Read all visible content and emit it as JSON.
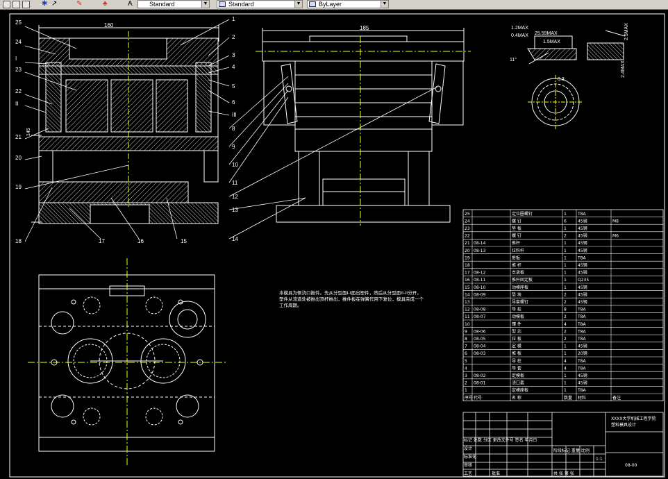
{
  "toolbar": {
    "style_combo_1": "Standard",
    "style_combo_2": "Standard",
    "style_combo_3": "ByLayer",
    "icons": [
      "new-icon",
      "open-icon",
      "save-icon",
      "pan-icon",
      "zoom-icon",
      "paint-icon",
      "text-style-icon",
      "dim-style-icon",
      "layer-icon"
    ]
  },
  "drawing": {
    "colors": {
      "line": "#ffffff",
      "hatch": "#ffffff",
      "background": "#000000",
      "yellow": "#ffff00"
    },
    "dims": {
      "width_160": "160",
      "width_185": "185",
      "height_145": "145"
    },
    "callouts_left": [
      "25",
      "24",
      "I",
      "23",
      "22",
      "II",
      "21",
      "20",
      "19",
      "18"
    ],
    "callouts_bottom": [
      "17",
      "16",
      "15"
    ],
    "callouts_right": [
      "1",
      "2",
      "3",
      "4",
      "5",
      "6",
      "7",
      "III",
      "8",
      "9",
      "10",
      "11",
      "12",
      "13",
      "14"
    ],
    "detail_labels": [
      "1.2MAX",
      "0.4MAX",
      "25.59MAX",
      "1.5MAX",
      "11°",
      "0.3",
      "2.4MAX",
      "2.5MAX"
    ],
    "notes": "本模具为侧浇口推件。先从分型面I-I面出塑件，然后从分型面II-II分开，塑件从流道处被推出顶杆推出，推件板在弹簧作用下复位，模具完成一个工作周期。"
  },
  "bom": {
    "rows": [
      {
        "no": "25",
        "code": "",
        "name": "定位圈螺钉",
        "qty": "1",
        "mat": "T8A",
        "note": ""
      },
      {
        "no": "24",
        "code": "",
        "name": "螺 钉",
        "qty": "6",
        "mat": "45钢",
        "note": "M8"
      },
      {
        "no": "23",
        "code": "",
        "name": "垫 板",
        "qty": "1",
        "mat": "45钢",
        "note": ""
      },
      {
        "no": "22",
        "code": "",
        "name": "螺 钉",
        "qty": "2",
        "mat": "45钢",
        "note": "M6"
      },
      {
        "no": "21",
        "code": "08-14",
        "name": "推杆",
        "qty": "1",
        "mat": "45钢",
        "note": ""
      },
      {
        "no": "20",
        "code": "08-13",
        "name": "拉料杆",
        "qty": "1",
        "mat": "45钢",
        "note": ""
      },
      {
        "no": "19",
        "code": "",
        "name": "推板",
        "qty": "1",
        "mat": "T8A",
        "note": ""
      },
      {
        "no": "18",
        "code": "",
        "name": "推 杆",
        "qty": "1",
        "mat": "45钢",
        "note": ""
      },
      {
        "no": "17",
        "code": "08-12",
        "name": "支承板",
        "qty": "1",
        "mat": "45钢",
        "note": ""
      },
      {
        "no": "16",
        "code": "08-11",
        "name": "推杆固定板",
        "qty": "1",
        "mat": "Q235",
        "note": ""
      },
      {
        "no": "15",
        "code": "08-10",
        "name": "动模座板",
        "qty": "1",
        "mat": "45钢",
        "note": ""
      },
      {
        "no": "14",
        "code": "08-09",
        "name": "垫 块",
        "qty": "2",
        "mat": "45钢",
        "note": ""
      },
      {
        "no": "13",
        "code": "",
        "name": "导套螺钉",
        "qty": "2",
        "mat": "45钢",
        "note": ""
      },
      {
        "no": "12",
        "code": "08-08",
        "name": "导 柱",
        "qty": "8",
        "mat": "T8A",
        "note": ""
      },
      {
        "no": "11",
        "code": "08-07",
        "name": "动模板",
        "qty": "2",
        "mat": "T8A",
        "note": ""
      },
      {
        "no": "10",
        "code": "",
        "name": "镶 件",
        "qty": "4",
        "mat": "T8A",
        "note": ""
      },
      {
        "no": "9",
        "code": "08-06",
        "name": "型 芯",
        "qty": "2",
        "mat": "T8A",
        "note": ""
      },
      {
        "no": "8",
        "code": "08-05",
        "name": "拉 板",
        "qty": "2",
        "mat": "T8A",
        "note": ""
      },
      {
        "no": "7",
        "code": "08-04",
        "name": "定 模",
        "qty": "1",
        "mat": "45钢",
        "note": ""
      },
      {
        "no": "6",
        "code": "08-03",
        "name": "推 板",
        "qty": "1",
        "mat": "20钢",
        "note": ""
      },
      {
        "no": "5",
        "code": "",
        "name": "导 柱",
        "qty": "4",
        "mat": "T8A",
        "note": ""
      },
      {
        "no": "4",
        "code": "",
        "name": "导 套",
        "qty": "4",
        "mat": "T8A",
        "note": ""
      },
      {
        "no": "3",
        "code": "08-02",
        "name": "定模板",
        "qty": "1",
        "mat": "45钢",
        "note": ""
      },
      {
        "no": "2",
        "code": "08-01",
        "name": "浇口套",
        "qty": "1",
        "mat": "45钢",
        "note": ""
      },
      {
        "no": "1",
        "code": "",
        "name": "定模座板",
        "qty": "1",
        "mat": "T8A",
        "note": ""
      }
    ],
    "header": {
      "no": "序号",
      "code": "代号",
      "name": "名 称",
      "qty": "数量",
      "mat": "材料",
      "note": "备注"
    },
    "title_block": {
      "school": "XXXX大学机械工程学院",
      "project": "塑料模具设计",
      "drawing_no": "08-00",
      "scale": "1:1",
      "row1": "标记 处数 分区 更改文件号 签名 年月日",
      "designer": "设计",
      "checker": "审核",
      "process": "工艺",
      "std": "标准化",
      "approve": "批准",
      "stage": "阶段标记 重量 比例",
      "sheet": "共 张 第 张"
    }
  }
}
